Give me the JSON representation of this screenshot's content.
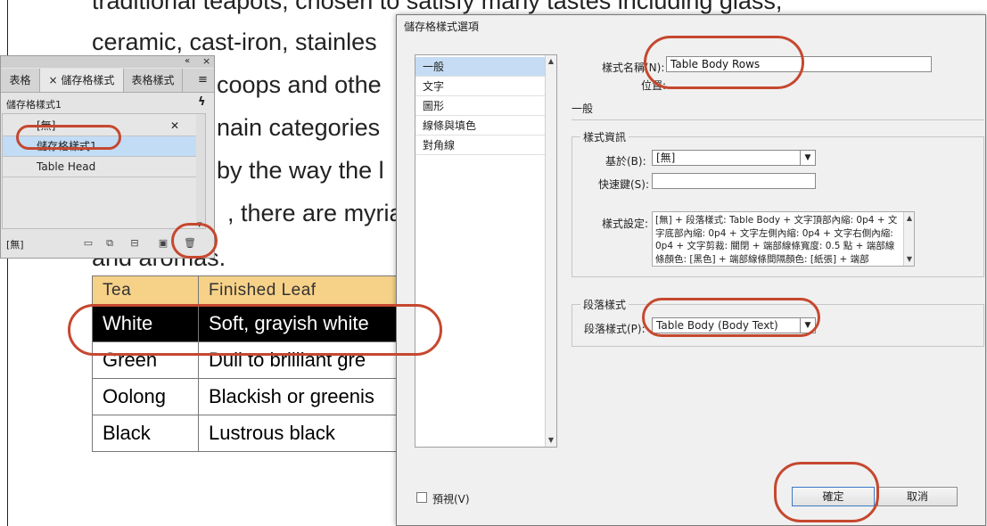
{
  "document": {
    "lines": [
      "traditional teapots, chosen to satisfy many tastes including glass,",
      "ceramic, cast-iron, stainles",
      "coops and othe",
      "nain categories",
      "by the way the l",
      ", there are myria",
      "and aromas."
    ],
    "table": {
      "header": [
        "Tea",
        "Finished Leaf"
      ],
      "rows": [
        [
          "White",
          "Soft, grayish white"
        ],
        [
          "Green",
          "Dull to brilliant gre"
        ],
        [
          "Oolong",
          "Blackish or greenis"
        ],
        [
          "Black",
          "Lustrous black"
        ]
      ]
    }
  },
  "panel": {
    "tabs": [
      "表格",
      "儲存格樣式",
      "表格樣式"
    ],
    "current_style": "儲存格樣式1",
    "items": [
      "[無]",
      "儲存格樣式1",
      "Table Head"
    ],
    "footer_label": "[無]",
    "collapse_glyph": "«",
    "close_glyph": "×",
    "menu_glyph": "≡",
    "lightning_glyph": "ϟ"
  },
  "dialog": {
    "title": "儲存格樣式選項",
    "nav": [
      "一般",
      "文字",
      "圖形",
      "線條與填色",
      "對角線"
    ],
    "style_name_label": "樣式名稱(N):",
    "style_name_value": "Table Body Rows",
    "location_label": "位置:",
    "section_general": "一般",
    "style_info_title": "樣式資訊",
    "based_on_label": "基於(B):",
    "based_on_value": "[無]",
    "shortcut_label": "快速鍵(S):",
    "shortcut_value": "",
    "style_settings_label": "樣式設定:",
    "style_settings_text": "[無] + 段落樣式: Table Body + 文字頂部內縮: 0p4 + 文字底部內縮: 0p4 + 文字左側內縮: 0p4 + 文字右側內縮: 0p4 + 文字剪裁: 關閉 + 端部線條寬度: 0.5 點 + 端部線條顏色: [黑色] + 端部線條間隔顏色: [紙張] + 端部",
    "para_group_title": "段落樣式",
    "para_style_label": "段落樣式(P):",
    "para_style_value": "Table Body (Body Text)",
    "preview_label": "預視(V)",
    "ok_label": "確定",
    "cancel_label": "取消"
  },
  "colors": {
    "highlight_ring": "#c5482f",
    "table_header": "#f6d188",
    "selection_blue": "#c6dcf4"
  }
}
